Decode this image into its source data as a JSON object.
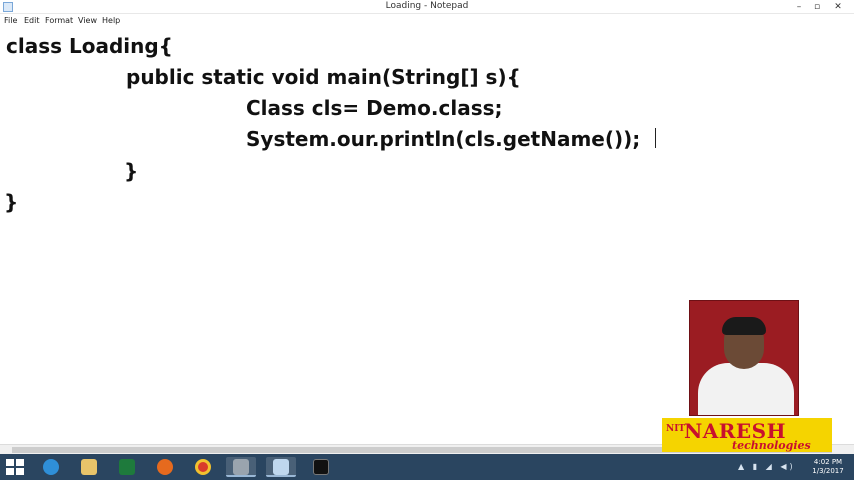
{
  "window": {
    "title": "Loading - Notepad",
    "minimize": "–",
    "maximize": "▫",
    "close": "✕"
  },
  "menu": {
    "items": [
      "File",
      "Edit",
      "Format",
      "View",
      "Help"
    ]
  },
  "editor": {
    "lines": [
      "class Loading{",
      "public static void main(String[] s){",
      "Class cls= Demo.class;",
      "System.our.println(cls.getName());",
      "}",
      "}"
    ]
  },
  "logo": {
    "prefix": "NIT",
    "name": "NARESH",
    "subtitle": "technologies"
  },
  "taskbar": {
    "icons": [
      "start-icon",
      "ie-icon",
      "file-explorer-icon",
      "excel-icon",
      "firefox-icon",
      "chrome-icon",
      "tools-icon",
      "notepad-icon",
      "cmd-icon"
    ],
    "tray_icons": "▲ ▮ ◢ ◀)",
    "time": "4:02 PM",
    "date": "1/3/2017"
  },
  "colors": {
    "taskbar": "#2a4560",
    "logo_bg": "#f5d400",
    "logo_text": "#c8102e",
    "webcam_bg": "#9b1c22"
  }
}
